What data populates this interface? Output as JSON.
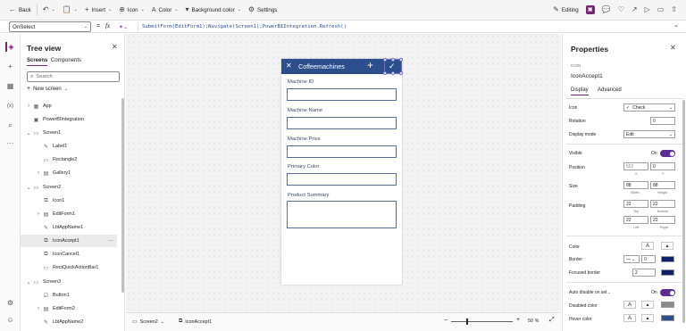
{
  "toolbar": {
    "back": "Back",
    "insert": "Insert",
    "icon": "Icon",
    "color": "Color",
    "background_color": "Background color",
    "settings": "Settings",
    "editing": "Editing"
  },
  "formula": {
    "property": "OnSelect",
    "fx": "fx",
    "expression": "SubmitForm(EditForm1);Navigate(Screen1);PowerBIIntegration.Refresh()"
  },
  "tree": {
    "title": "Tree view",
    "tabs": [
      "Screens",
      "Components"
    ],
    "search_placeholder": "Search",
    "new_screen": "New screen",
    "items": [
      "App",
      "PowerBIIntegration",
      "Screen1",
      "Label1",
      "Rectangle2",
      "Gallery1",
      "Screen2",
      "Icon1",
      "EditForm1",
      "LblAppName1",
      "IconAccept1",
      "IconCancel1",
      "RectQuickActionBar1",
      "Screen3",
      "Button1",
      "EditForm2",
      "LblAppName2"
    ]
  },
  "app_screen": {
    "title": "Coffeemachines",
    "fields": [
      "Machine ID",
      "Machine Name",
      "Machine Price",
      "Primary Color",
      "Product Summary"
    ]
  },
  "status": {
    "screen": "Screen2",
    "control": "IconAccept1",
    "zoom": "50",
    "zoom_unit": "%"
  },
  "props": {
    "title": "Properties",
    "type": "ICON",
    "name": "IconAccept1",
    "tabs": [
      "Display",
      "Advanced"
    ],
    "icon_label": "Icon",
    "icon_value": "Check",
    "rotation_label": "Rotation",
    "rotation_value": "0",
    "display_mode_label": "Display mode",
    "display_mode_value": "Edit",
    "visible_label": "Visible",
    "visible_value": "On",
    "position_label": "Position",
    "pos_x": "552",
    "pos_y": "0",
    "x_lbl": "X",
    "y_lbl": "Y",
    "size_label": "Size",
    "width": "88",
    "height": "88",
    "width_lbl": "Width",
    "height_lbl": "Height",
    "padding_label": "Padding",
    "pad_top": "22",
    "pad_bottom": "22",
    "pad_left": "22",
    "pad_right": "22",
    "top_lbl": "Top",
    "bottom_lbl": "Bottom",
    "left_lbl": "Left",
    "right_lbl": "Right",
    "color_label": "Color",
    "border_label": "Border",
    "border_width": "0",
    "focused_border_label": "Focused border",
    "focused_border_value": "2",
    "auto_disable_label": "Auto disable on sel...",
    "auto_disable_value": "On",
    "disabled_color_label": "Disabled color",
    "hover_color_label": "Hover color",
    "swatch_navy": "#0f1f6b",
    "swatch_gray": "#8a8a8a",
    "swatch_blue": "#2d4e8c"
  },
  "colors": {
    "accent": "#742774",
    "header": "#2d4e8c"
  }
}
